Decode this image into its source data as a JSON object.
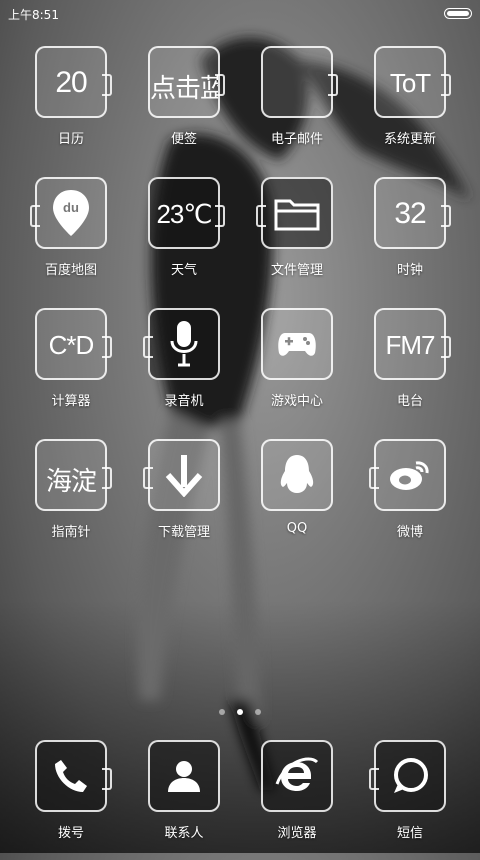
{
  "status_bar": {
    "time": "上午8:51"
  },
  "apps": [
    {
      "label": "日历",
      "tile_text": "20",
      "icon": "calendar-icon"
    },
    {
      "label": "便签",
      "tile_text": "点击蓝",
      "icon": "notes-icon"
    },
    {
      "label": "电子邮件",
      "tile_text": "",
      "icon": "email-icon"
    },
    {
      "label": "系统更新",
      "tile_text": "ToT",
      "icon": "update-icon"
    },
    {
      "label": "百度地图",
      "tile_text": "du",
      "icon": "map-pin-icon"
    },
    {
      "label": "天气",
      "tile_text": "23℃",
      "icon": "weather-icon"
    },
    {
      "label": "文件管理",
      "tile_text": "",
      "icon": "folder-icon"
    },
    {
      "label": "时钟",
      "tile_text": "32",
      "icon": "clock-icon"
    },
    {
      "label": "计算器",
      "tile_text": "C*D",
      "icon": "calculator-icon"
    },
    {
      "label": "录音机",
      "tile_text": "",
      "icon": "microphone-icon"
    },
    {
      "label": "游戏中心",
      "tile_text": "",
      "icon": "gamepad-icon"
    },
    {
      "label": "电台",
      "tile_text": "FM7",
      "icon": "radio-icon"
    },
    {
      "label": "指南针",
      "tile_text": "海淀",
      "icon": "compass-icon"
    },
    {
      "label": "下载管理",
      "tile_text": "",
      "icon": "download-arrow-icon"
    },
    {
      "label": "QQ",
      "tile_text": "",
      "icon": "qq-penguin-icon"
    },
    {
      "label": "微博",
      "tile_text": "",
      "icon": "weibo-icon"
    }
  ],
  "page_indicator": {
    "total": 3,
    "current": 2
  },
  "dock": [
    {
      "label": "拨号",
      "icon": "phone-icon"
    },
    {
      "label": "联系人",
      "icon": "contact-person-icon"
    },
    {
      "label": "浏览器",
      "icon": "browser-e-icon"
    },
    {
      "label": "短信",
      "icon": "message-bubble-icon"
    }
  ]
}
